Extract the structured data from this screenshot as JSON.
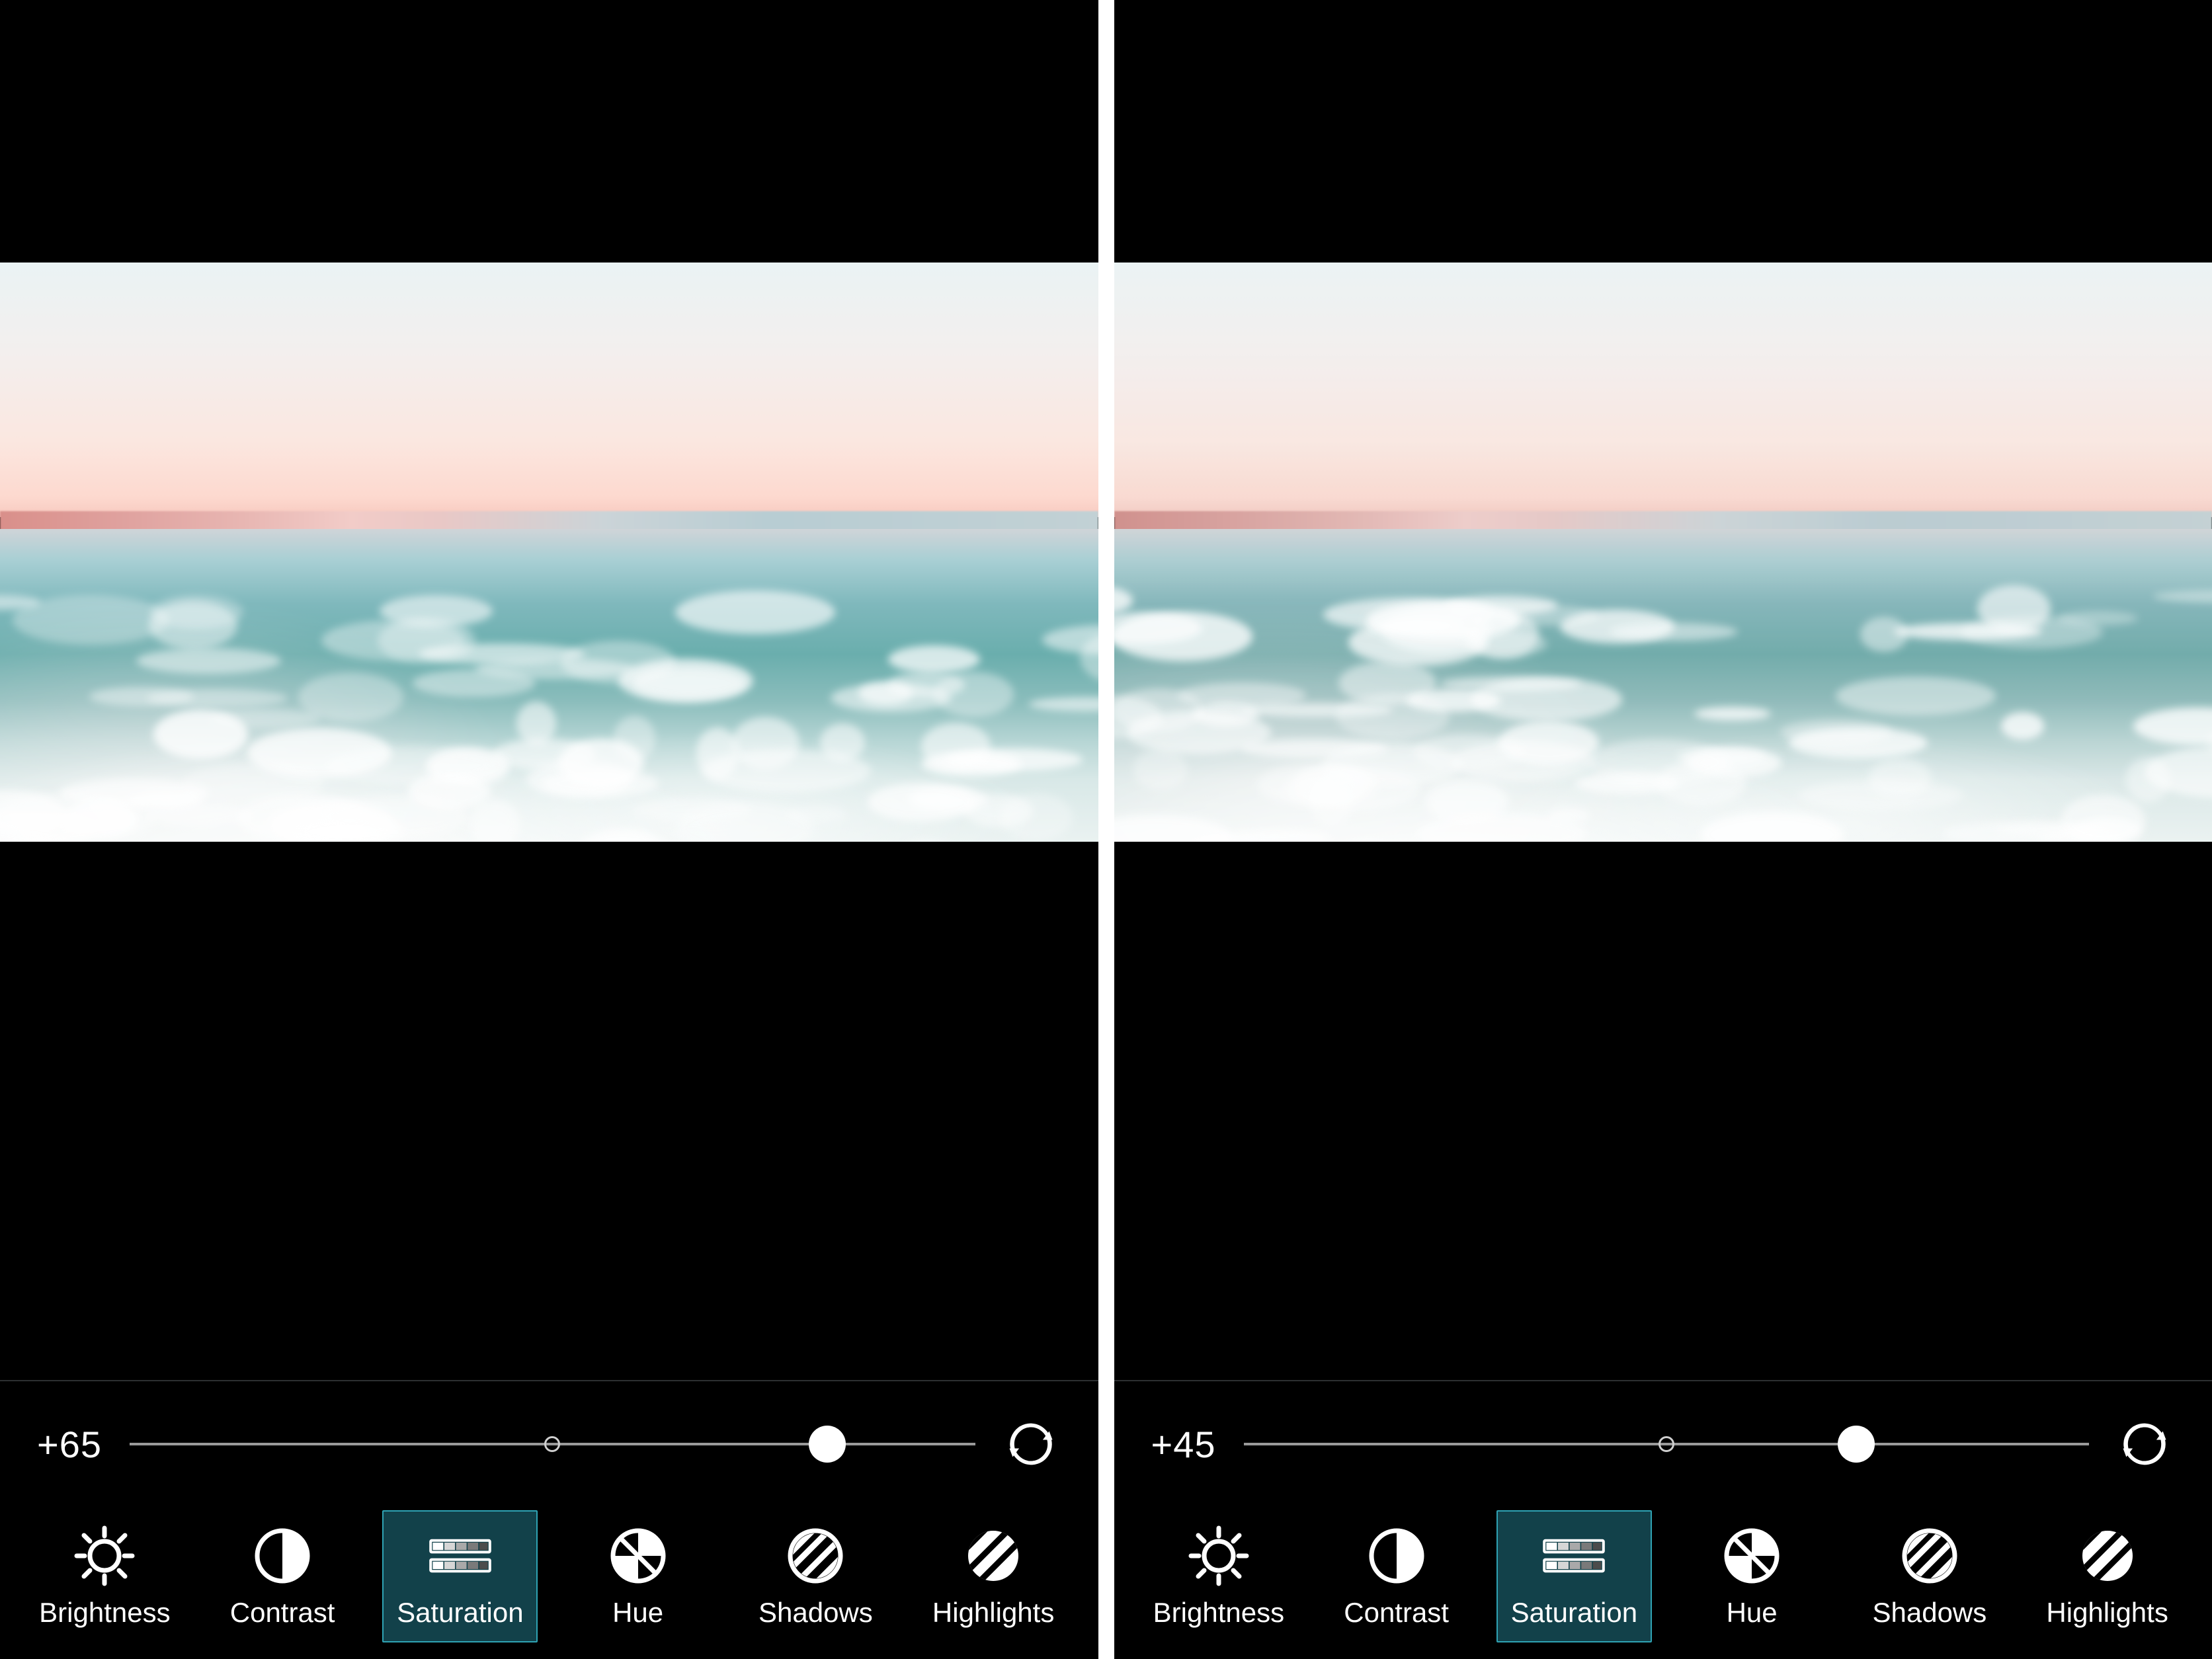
{
  "panels": [
    {
      "slider": {
        "display": "+65",
        "value": 65,
        "min": -100,
        "max": 100
      },
      "tools": [
        {
          "id": "brightness",
          "label": "Brightness",
          "icon": "brightness-icon",
          "selected": false
        },
        {
          "id": "contrast",
          "label": "Contrast",
          "icon": "contrast-icon",
          "selected": false
        },
        {
          "id": "saturation",
          "label": "Saturation",
          "icon": "saturation-icon",
          "selected": true
        },
        {
          "id": "hue",
          "label": "Hue",
          "icon": "hue-icon",
          "selected": false
        },
        {
          "id": "shadows",
          "label": "Shadows",
          "icon": "shadows-icon",
          "selected": false
        },
        {
          "id": "highlights",
          "label": "Highlights",
          "icon": "highlights-icon",
          "selected": false
        }
      ],
      "saturation_boost": 1.0
    },
    {
      "slider": {
        "display": "+45",
        "value": 45,
        "min": -100,
        "max": 100
      },
      "tools": [
        {
          "id": "brightness",
          "label": "Brightness",
          "icon": "brightness-icon",
          "selected": false
        },
        {
          "id": "contrast",
          "label": "Contrast",
          "icon": "contrast-icon",
          "selected": false
        },
        {
          "id": "saturation",
          "label": "Saturation",
          "icon": "saturation-icon",
          "selected": true
        },
        {
          "id": "hue",
          "label": "Hue",
          "icon": "hue-icon",
          "selected": false
        },
        {
          "id": "shadows",
          "label": "Shadows",
          "icon": "shadows-icon",
          "selected": false
        },
        {
          "id": "highlights",
          "label": "Highlights",
          "icon": "highlights-icon",
          "selected": false
        }
      ],
      "saturation_boost": 0.85
    }
  ],
  "reset_button_label": "Reset",
  "colors": {
    "selected_bg": "#12414a",
    "selected_border": "#2fa3b4",
    "text": "#ffffff"
  }
}
